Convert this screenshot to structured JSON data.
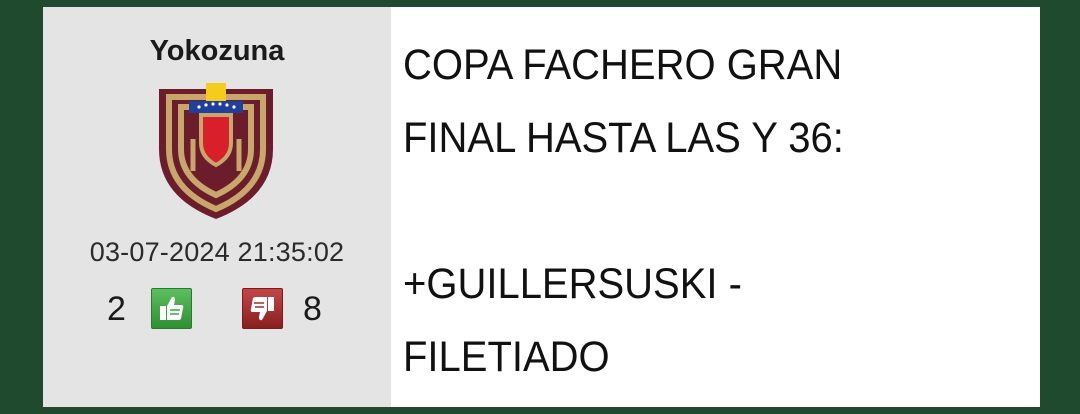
{
  "post": {
    "username": "Yokozuna",
    "timestamp": "03-07-2024 21:35:02",
    "thumbs_up_count": "2",
    "thumbs_down_count": "8",
    "message_lines": [
      "COPA FACHERO GRAN",
      "FINAL HASTA LAS Y 36:",
      "",
      "+GUILLERSUSKI -",
      "FILETIADO"
    ]
  },
  "icons": {
    "avatar": "venezuela-federation-crest-icon",
    "thumbs_up": "thumbs-up-icon",
    "thumbs_down": "thumbs-down-icon"
  },
  "colors": {
    "background": "#1f4a2e",
    "sidebar": "#e4e4e4",
    "message_bg": "#ffffff",
    "crest_maroon": "#6b1d2c",
    "crest_gold": "#c9a66b",
    "thumbs_up": "#3fa343",
    "thumbs_down": "#a32a2a"
  }
}
